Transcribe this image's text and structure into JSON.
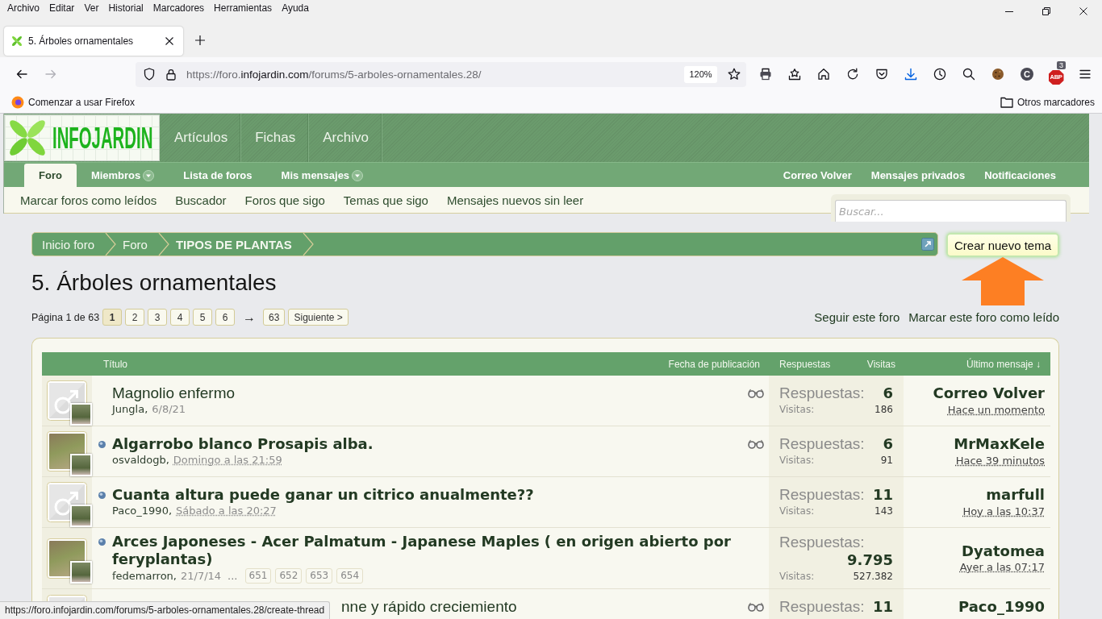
{
  "browser": {
    "menu": [
      "Archivo",
      "Editar",
      "Ver",
      "Historial",
      "Marcadores",
      "Herramientas",
      "Ayuda"
    ],
    "tab": {
      "title": "5. Árboles ornamentales"
    },
    "nav_buttons": [
      {
        "kind": "back",
        "disabled": false
      },
      {
        "kind": "forward",
        "disabled": true
      }
    ],
    "url": {
      "prefix": "https://foro.",
      "domain": "infojardin.com",
      "path": "/forums/5-arboles-ornamentales.28/"
    },
    "zoom": "120%",
    "extensions": [
      {
        "kind": "cookie"
      },
      {
        "kind": "letter",
        "label": "C"
      },
      {
        "kind": "adblock",
        "label": "ABP",
        "badge": "3"
      }
    ],
    "bookmarks": [
      {
        "label": "Comenzar a usar Firefox"
      }
    ],
    "other_bookmarks": "Otros marcadores"
  },
  "site": {
    "logo": "INFOJARDIN",
    "main_nav": [
      "Artículos",
      "Fichas",
      "Archivo"
    ],
    "tabs": [
      {
        "label": "Foro",
        "selected": true,
        "dropdown": false
      },
      {
        "label": "Miembros",
        "selected": false,
        "dropdown": true
      },
      {
        "label": "Lista de foros",
        "selected": false,
        "dropdown": false
      },
      {
        "label": "Mis mensajes",
        "selected": false,
        "dropdown": true
      }
    ],
    "user_links": [
      "Correo Volver",
      "Mensajes privados",
      "Notificaciones"
    ],
    "sub_nav": [
      "Marcar foros como leídos",
      "Buscador",
      "Foros que sigo",
      "Temas que sigo",
      "Mensajes nuevos sin leer"
    ],
    "search": {
      "placeholder": "Buscar..."
    }
  },
  "breadcrumb": [
    {
      "label": "Inicio foro",
      "current": false
    },
    {
      "label": "Foro",
      "current": false
    },
    {
      "label": "TIPOS DE PLANTAS",
      "current": true
    }
  ],
  "create_button": "Crear nuevo tema",
  "forum_title": "5. Árboles ornamentales",
  "pagination": {
    "label": "Página 1 de 63",
    "items": [
      {
        "kind": "page",
        "label": "1",
        "selected": true
      },
      {
        "kind": "page",
        "label": "2",
        "selected": false
      },
      {
        "kind": "page",
        "label": "3",
        "selected": false
      },
      {
        "kind": "page",
        "label": "4",
        "selected": false
      },
      {
        "kind": "page",
        "label": "5",
        "selected": false
      },
      {
        "kind": "page",
        "label": "6",
        "selected": false
      },
      {
        "kind": "skip",
        "label": "→"
      },
      {
        "kind": "page",
        "label": "63",
        "selected": false
      },
      {
        "kind": "next",
        "label": "Siguiente >",
        "selected": false
      }
    ]
  },
  "forum_actions": [
    "Seguir este foro",
    "Marcar este foro como leído"
  ],
  "table": {
    "columns": [
      "Título",
      "Fecha de publicación",
      "Respuestas",
      "Visitas",
      "Último mensaje ↓"
    ],
    "rows": [
      {
        "avatar": {
          "kind": "default"
        },
        "poster_thumbnail": true,
        "unread": false,
        "covered": false,
        "title": "Magnolio enfermo",
        "author": "Jungla,",
        "date": "6/8/21",
        "date_underlined": false,
        "watched": true,
        "replies_label": "Respuestas:",
        "replies": "6",
        "views_label": "Visitas:",
        "views": "186",
        "last_user": "Correo Volver",
        "last_time": "Hace un momento"
      },
      {
        "avatar": {
          "kind": "photo"
        },
        "poster_thumbnail": true,
        "unread": true,
        "covered": false,
        "title": "Algarrobo blanco Prosapis alba.",
        "author": "osvaldogb,",
        "date": "Domingo a las 21:59",
        "date_underlined": true,
        "watched": true,
        "replies_label": "Respuestas:",
        "replies": "6",
        "views_label": "Visitas:",
        "views": "91",
        "last_user": "MrMaxKele",
        "last_time": "Hace 39 minutos"
      },
      {
        "avatar": {
          "kind": "default"
        },
        "poster_thumbnail": true,
        "unread": true,
        "covered": false,
        "title": "Cuanta altura puede ganar un citrico anualmente??",
        "author": "Paco_1990,",
        "date": "Sábado a las 20:27",
        "date_underlined": true,
        "watched": false,
        "replies_label": "Respuestas:",
        "replies": "11",
        "views_label": "Visitas:",
        "views": "143",
        "last_user": "marfull",
        "last_time": "Hoy a las 10:37"
      },
      {
        "avatar": {
          "kind": "photo"
        },
        "poster_thumbnail": true,
        "unread": true,
        "covered": false,
        "title": "Arces Japoneses - Acer Palmatum - Japanese Maples ( en origen abierto por feryplantas)",
        "author": "fedemarron,",
        "date": "21/7/14",
        "date_underlined": false,
        "page_gap": "...",
        "page_links": [
          "651",
          "652",
          "653",
          "654"
        ],
        "watched": false,
        "replies_label": "Respuestas:",
        "replies": "9.795",
        "views_label": "Visitas:",
        "views": "527.382",
        "last_user": "Dyatomea",
        "last_time": "Ayer a las 07:17"
      },
      {
        "avatar": {
          "kind": "default"
        },
        "poster_thumbnail": false,
        "unread": false,
        "covered": true,
        "title": "nne y rápido creciemiento",
        "watched": true,
        "replies_label": "Respuestas:",
        "replies": "11",
        "last_user": "Paco_1990"
      }
    ]
  },
  "status_url": "https://foro.infojardin.com/forums/5-arboles-ornamentales.28/create-thread"
}
